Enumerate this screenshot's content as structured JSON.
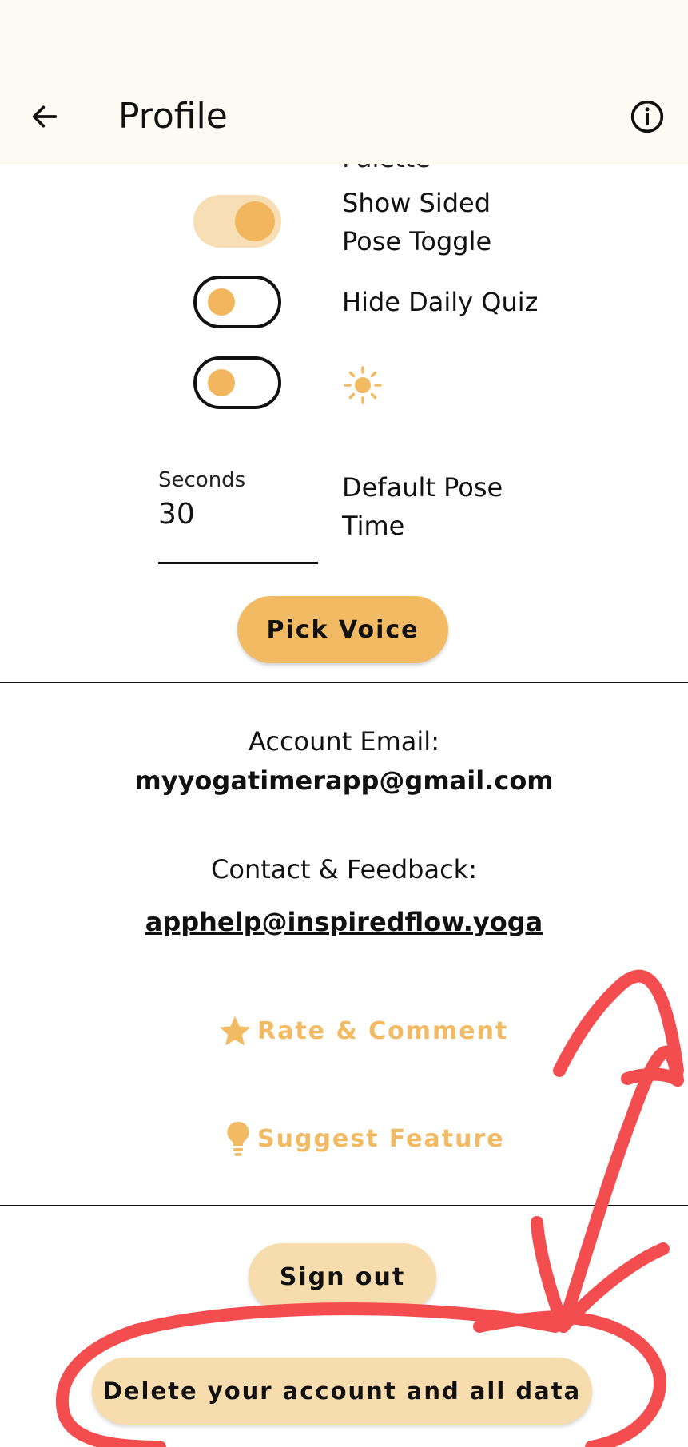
{
  "header": {
    "title": "Profile",
    "back_icon": "arrow-left-icon",
    "info_icon": "info-circle-icon"
  },
  "settings": {
    "partial_label": "Palette",
    "toggles": [
      {
        "label": "Show Sided Pose Toggle",
        "state": "on"
      },
      {
        "label": "Hide Daily Quiz",
        "state": "off"
      },
      {
        "label_icon": "sun-icon",
        "state": "off"
      }
    ],
    "default_pose_time": {
      "field_label": "Seconds",
      "value": "30",
      "label": "Default Pose Time"
    },
    "pick_voice_label": "Pick Voice"
  },
  "account": {
    "email_label": "Account Email:",
    "email": "myyogatimerapp@gmail.com",
    "contact_label": "Contact & Feedback:",
    "contact_email": "apphelp@inspiredflow.yoga"
  },
  "actions": {
    "rate_label": "Rate & Comment",
    "rate_icon": "star-icon",
    "suggest_label": "Suggest Feature",
    "suggest_icon": "lightbulb-icon"
  },
  "footer": {
    "sign_out_label": "Sign out",
    "delete_label": "Delete your account and all data"
  },
  "colors": {
    "accent": "#f2ba62",
    "accent_light": "#f7dcae",
    "header_bg": "#fdf9f3",
    "annotation": "#f44d50"
  }
}
